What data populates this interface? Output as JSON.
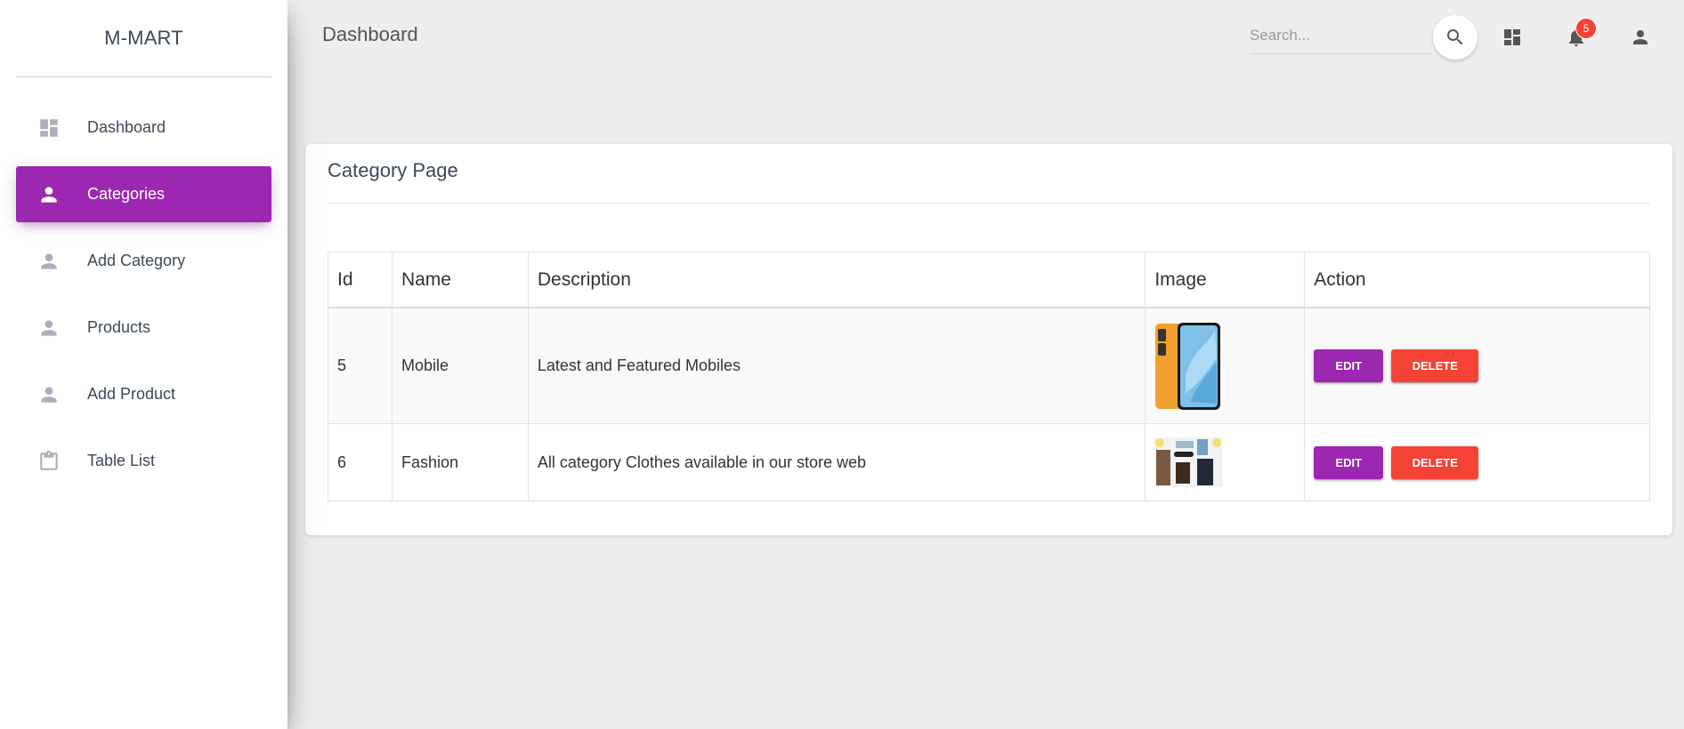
{
  "sidebar": {
    "brand": "M-MART",
    "items": [
      {
        "label": "Dashboard",
        "icon": "dashboard-icon",
        "active": false
      },
      {
        "label": "Categories",
        "icon": "person-icon",
        "active": true
      },
      {
        "label": "Add Category",
        "icon": "person-icon",
        "active": false
      },
      {
        "label": "Products",
        "icon": "person-icon",
        "active": false
      },
      {
        "label": "Add Product",
        "icon": "person-icon",
        "active": false
      },
      {
        "label": "Table List",
        "icon": "clipboard-icon",
        "active": false
      }
    ]
  },
  "topbar": {
    "title": "Dashboard",
    "search_placeholder": "Search...",
    "notification_count": "5"
  },
  "card": {
    "title": "Category Page",
    "table": {
      "headers": [
        "Id",
        "Name",
        "Description",
        "Image",
        "Action"
      ],
      "rows": [
        {
          "id": "5",
          "name": "Mobile",
          "description": "Latest and Featured Mobiles",
          "image": "mobile-phone-thumbnail"
        },
        {
          "id": "6",
          "name": "Fashion",
          "description": "All category Clothes available in our store web",
          "image": "fashion-clothes-thumbnail"
        }
      ],
      "edit_label": "EDIT",
      "delete_label": "DELETE"
    }
  },
  "colors": {
    "primary": "#9c27b0",
    "danger": "#f44336",
    "background": "#eeeeee"
  }
}
